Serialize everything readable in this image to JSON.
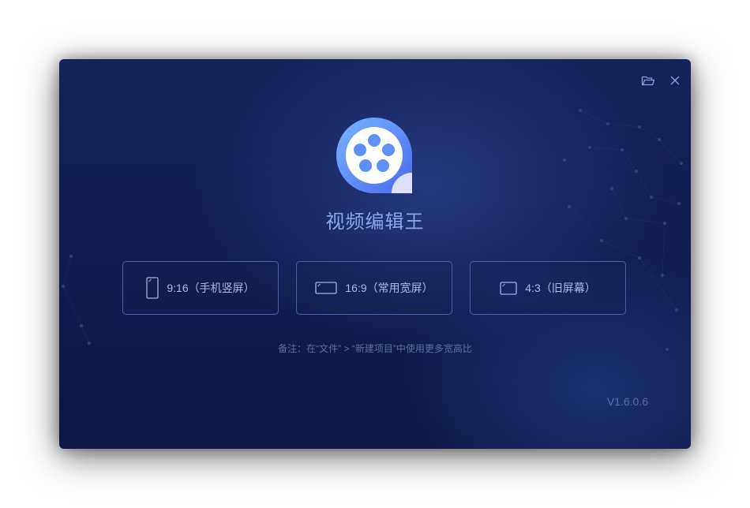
{
  "app": {
    "title": "视频编辑王",
    "version": "V1.6.0.6"
  },
  "toolbar": {
    "open_icon": "folder-open-icon",
    "close_icon": "close-icon"
  },
  "ratios": [
    {
      "label": "9:16（手机竖屏）",
      "icon": "portrait-screen-icon"
    },
    {
      "label": "16:9（常用宽屏）",
      "icon": "widescreen-icon"
    },
    {
      "label": "4:3（旧屏幕）",
      "icon": "standard-screen-icon"
    }
  ],
  "note": "备注：在“文件” > “新建项目”中使用更多宽高比",
  "colors": {
    "background": "#131c52",
    "accent": "#8ea3ee",
    "button_border": "#4a5fb0",
    "logo_blue": "#4d74f0"
  }
}
